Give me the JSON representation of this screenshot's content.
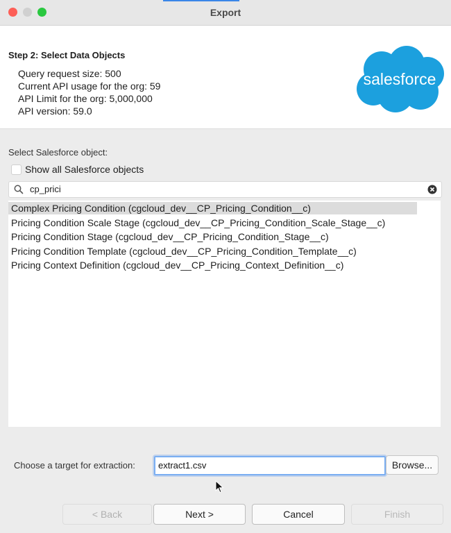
{
  "window": {
    "title": "Export"
  },
  "header": {
    "step_title": "Step 2: Select Data Objects",
    "info": [
      "Query request size: 500",
      "Current API usage for the org: 59",
      "API Limit for the org: 5,000,000",
      "API version: 59.0"
    ],
    "logo_text": "salesforce",
    "logo_color": "#1ca0de"
  },
  "object_select": {
    "label": "Select Salesforce object:",
    "show_all_label": "Show all Salesforce objects",
    "show_all_checked": false,
    "search_value": "cp_prici",
    "items": [
      {
        "label": "Complex Pricing Condition (cgcloud_dev__CP_Pricing_Condition__c)",
        "selected": true
      },
      {
        "label": "Pricing Condition Scale Stage (cgcloud_dev__CP_Pricing_Condition_Scale_Stage__c)",
        "selected": false
      },
      {
        "label": "Pricing Condition Stage (cgcloud_dev__CP_Pricing_Condition_Stage__c)",
        "selected": false
      },
      {
        "label": "Pricing Condition Template (cgcloud_dev__CP_Pricing_Condition_Template__c)",
        "selected": false
      },
      {
        "label": "Pricing Context Definition (cgcloud_dev__CP_Pricing_Context_Definition__c)",
        "selected": false
      }
    ]
  },
  "target": {
    "label": "Choose a target for extraction:",
    "value": "extract1.csv",
    "browse_label": "Browse..."
  },
  "buttons": {
    "back": "< Back",
    "next": "Next >",
    "cancel": "Cancel",
    "finish": "Finish"
  }
}
